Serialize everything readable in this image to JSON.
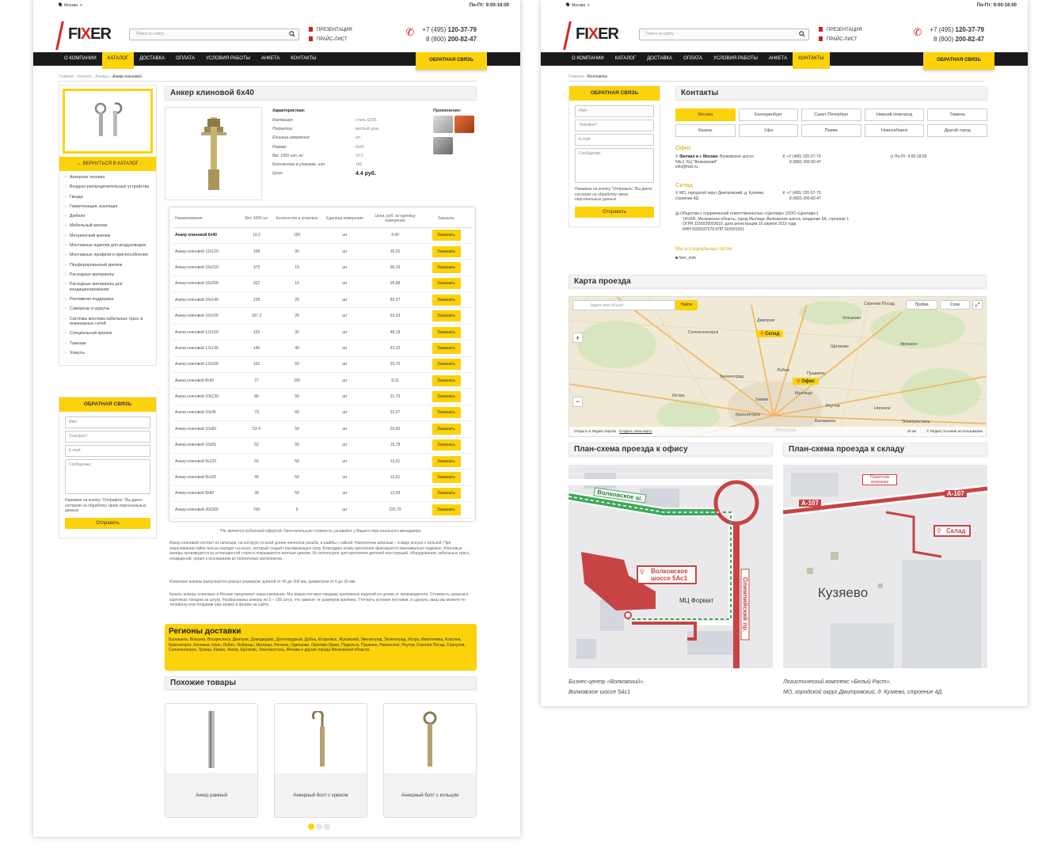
{
  "common": {
    "city": "Москва",
    "hours": "Пн-Пт: 9:00-18:00",
    "search_placeholder": "Поиск по сайту",
    "docs": [
      "ПРЕЗЕНТАЦИЯ",
      "ПРАЙС-ЛИСТ"
    ],
    "phone1_prefix": "+7 (495) ",
    "phone1_main": "120-37-79",
    "phone2_prefix": "8 (800) ",
    "phone2_main": "200-82-47",
    "logo_a": "FI",
    "logo_b": "X",
    "logo_c": "ER",
    "nav": [
      "О КОМПАНИИ",
      "КАТАЛОГ",
      "ДОСТАВКА",
      "ОПЛАТА",
      "УСЛОВИЯ РАБОТЫ",
      "АНКЕТА",
      "КОНТАКТЫ"
    ],
    "feedback_btn": "ОБРАТНАЯ СВЯЗЬ",
    "form": {
      "title": "ОБРАТНАЯ СВЯЗЬ",
      "name": "Имя:",
      "phone": "Телефон*:",
      "email": "E-mail:",
      "message": "Сообщение:",
      "note": "Нажимая на кнопку \"Отправить\" Вы даете согласие на обработку своих персональных данных",
      "submit": "Отправить"
    },
    "accent": "#fcd20a"
  },
  "product_page": {
    "breadcrumbs": [
      "Главная",
      "Каталог",
      "Анкеры",
      "Анкер клиновой"
    ],
    "back_label": "ВЕРНУТЬСЯ В КАТАЛОГ",
    "categories": [
      "Анкерная техника",
      "Воздухо-распределительные устройства",
      "Гвозди",
      "Герметизация, изоляция",
      "Дюбели",
      "Мебельный крепеж",
      "Метрический крепеж",
      "Монтажные изделия для воздуховодов",
      "Монтажные профили и приспособления",
      "Перфорированный крепеж",
      "Расходные материалы",
      "Расходные материалы для кондиционирования",
      "Рекламная поддержка",
      "Саморезы и шурупы",
      "Системы монтажа кабельных трасс и инженерных сетей",
      "Специальный крепеж",
      "Такелаж",
      "Хомуты"
    ],
    "title": "Анкер клиновой 6х40",
    "characteristics_title": "Характеристики:",
    "characteristics": [
      {
        "k": "Материал:",
        "v": "сталь Q235"
      },
      {
        "k": "Покрытие:",
        "v": "желтый цинк"
      },
      {
        "k": "Единица измерения:",
        "v": "шт"
      },
      {
        "k": "Размер:",
        "v": "6х40"
      },
      {
        "k": "Вес 1000 шт, кг:",
        "v": "10.2"
      },
      {
        "k": "Количество в упаковке, шт:",
        "v": "150"
      },
      {
        "k": "Цена:",
        "v": "4.4 руб."
      }
    ],
    "applications_title": "Применение:",
    "table": {
      "headers": [
        "Наименование",
        "Вес 1000 шт",
        "Количество в упаковке",
        "Единица измерения",
        "Цена, руб. за единицу измерения",
        "Заказать"
      ],
      "order_label": "Заказать",
      "rows": [
        [
          "Анкер клиновой 6х40",
          "10.2",
          "150",
          "шт",
          "4,40"
        ],
        [
          "Анкер клиновой 12х120",
          "108",
          "30",
          "шт",
          "36,02"
        ],
        [
          "Анкер клиновой 16х220",
          "373",
          "15",
          "шт",
          "96,19"
        ],
        [
          "Анкер клиновой 16х200",
          "322",
          "15",
          "шт",
          "95,88"
        ],
        [
          "Анкер клиновой 16х140",
          "228",
          "25",
          "шт",
          "82,37"
        ],
        [
          "Анкер клиновой 16х105",
          "167.2",
          "25",
          "шт",
          "63,33"
        ],
        [
          "Анкер клиновой 12х150",
          "152",
          "30",
          "шт",
          "48,18"
        ],
        [
          "Анкер клиновой 12х135",
          "146",
          "40",
          "шт",
          "42,10"
        ],
        [
          "Анкер клиновой 12х100",
          "102",
          "50",
          "шт",
          "33,76"
        ],
        [
          "Анкер клиновой 8х50",
          "27",
          "100",
          "шт",
          "9,31"
        ],
        [
          "Анкер клиновой 10х120",
          "86",
          "50",
          "шт",
          "31,70"
        ],
        [
          "Анкер клиновой 10х95",
          "70",
          "60",
          "шт",
          "31,67"
        ],
        [
          "Анкер клиновой 10х80",
          "53.4",
          "50",
          "шт",
          "20,96"
        ],
        [
          "Анкер клиновой 10х65",
          "52",
          "50",
          "шт",
          "15,78"
        ],
        [
          "Анкер клиновой 8х120",
          "55",
          "50",
          "шт",
          "13,91"
        ],
        [
          "Анкер клиновой 8х105",
          "49",
          "50",
          "шт",
          "12,91"
        ],
        [
          "Анкер клиновой 8х80",
          "39",
          "50",
          "шт",
          "12,39"
        ],
        [
          "Анкер клиновой 20х300",
          "700",
          "5",
          "шт",
          "225,79"
        ]
      ]
    },
    "disclaimer": "*Не является публичной офертой. Окончательную стоимость узнавайте у Вашего персонального менеджера.",
    "desc1": "Анкер клиновой состоит из шпильки, на которую по всей длине нанесена резьба, и шайбы с гайкой. Наконечник шпильки – в виде конуса с гильзой. При закручивании гайки гильза находит на конус, который создаёт распирающую силу. Благодаря этому крепление фиксируется максимально надежно. Клиновые анкеры производятся из углеродистой стали и покрываются желтым цинком. Их используют для крепления деталей конструкций, оборудования, кабельных трасс, ограждений, перил к основаниям из полнотелых материалов.",
    "desc2": "Клиновые анкеры выпускаются разных размеров: длиной от 40 до 300 мм, диаметром от 6 до 20 мм.",
    "desc3": "Купить анкеры клиновые в Москве предлагает наша компания. Мы ведем оптовую продажу крепежных изделий по ценам от производителя. Стоимость указана в карточках товаров за штуку. Расфасованы анкеры по 5 – 150 штук, что зависит от размеров крепежа. Уточнить условия поставки, и сделать заказ вы можете по телефону или отправив нам заявку в форме на сайте.",
    "regions_title": "Регионы доставки",
    "regions_text": "Балашиха, Власиха, Воскресенск, Дмитров, Домодедово, Долгопрудный, Дубна, Егорьевск, Жуковский, Звенигород, Зеленоград, Истра, Ивантеевка, Королев, Красногорск, Коломна, Клин, Лобня, Люберцы, Мытищи, Ногинск, Одинцово, Орехово-Зуево, Подольск, Пушкино, Раменское, Реутов, Сергиев Посад, Серпухов, Солнечногорск, Троицк, Химки, Чехов, Щелково, Электросталь, Москва и другие города Московской области.",
    "similar_title": "Похожие товары",
    "similar": [
      "Анкер рамный",
      "Анкерный болт с крюком",
      "Анкерный болт с кольцом"
    ]
  },
  "contacts_page": {
    "breadcrumbs": [
      "Главная",
      "Контакты"
    ],
    "title": "Контакты",
    "cities": [
      "Москва",
      "Екатеринбург",
      "Санкт-Петербург",
      "Нижний Новгород",
      "Тюмень",
      "Казань",
      "Уфа",
      "Пермь",
      "Новосибирск",
      "Другой город"
    ],
    "office_title": "Офис",
    "office_addr_b": "Филиал в г. Москва:",
    "office_addr": " Волковское шоссе 5Ас1, БЦ \"Волковский\"",
    "office_email": "info@fixer.ru",
    "office_phone1": "+7 (495) 120-37-79",
    "office_phone2": "8 (800) 200-82-47",
    "office_hours": "Пн-Пт: 9:00-18:00",
    "warehouse_title": "Склад",
    "warehouse_addr": "МО, городской округ Дмитровский, д. Кузяево, строение 4Д",
    "warehouse_phone1": "+7 (495) 120-37-79",
    "warehouse_phone2": "8 (800) 200-82-47",
    "company": "Общество с ограниченной ответственностью «Центавр» (ООО «Центавр»)",
    "company2": "141006, Московская область, город Мытищи, Волковское шоссе, владение 5А, строение 1",
    "company3": "ОГРН 1155029003610, дата регистрации 16 апреля 2015 года",
    "company4": "ИНН 5029197278 КПП 502901001",
    "social_title": "Мы в социальных сетях",
    "social": "fixer_msk",
    "map_title": "Карта проезда",
    "map_search": "Адрес или объект",
    "map_find": "Найти",
    "map_traffic": "Пробки",
    "map_layers": "Слои",
    "map_open": "Открыть в Яндекс.Картах",
    "map_route": "Создать свою карту",
    "map_terms": "© Яндекс  Условия использования",
    "map_scale": "10 км",
    "map_labels": [
      {
        "t": "Высоковск"
      },
      {
        "t": "Сергиев Посад"
      },
      {
        "t": "Дмитров"
      },
      {
        "t": "Солнечногорск"
      },
      {
        "t": "Зеленоград"
      },
      {
        "t": "Пушкино"
      },
      {
        "t": "Истра"
      },
      {
        "t": "Химки"
      },
      {
        "t": "Мытищи"
      },
      {
        "t": "Красногорск"
      },
      {
        "t": "Балашиха"
      },
      {
        "t": "Ногинск"
      },
      {
        "t": "Электросталь"
      },
      {
        "t": "Москва"
      },
      {
        "t": "Реутов"
      },
      {
        "t": "Хотьково"
      },
      {
        "t": "Щёлково"
      },
      {
        "t": "Фрязино"
      },
      {
        "t": "Лобня"
      }
    ],
    "pin_warehouse": "Склад",
    "pin_office": "Офис",
    "plan_office_title": "План-схема проезда к офису",
    "plan_warehouse_title": "План-схема проезда к складу",
    "plan_office_labels": {
      "road1": "Волковское ш.",
      "target": "Волковское шоссе 5Ас1",
      "mc": "МЦ Формат",
      "road2": "Олимпийский пр."
    },
    "plan_wh_labels": {
      "road1": "А-107",
      "road2": "А-107",
      "monument": "Памятник морякам",
      "target": "Склад",
      "town": "Кузяево"
    },
    "caption_office": [
      "Бизнес-центр «Волковский».",
      "Волковское шоссе 5Ас1"
    ],
    "caption_warehouse": [
      "Логистический комплекс «Белый Раст».",
      "МО, городской округ Дмитровский, д. Кузяево, строение 4Д."
    ]
  }
}
